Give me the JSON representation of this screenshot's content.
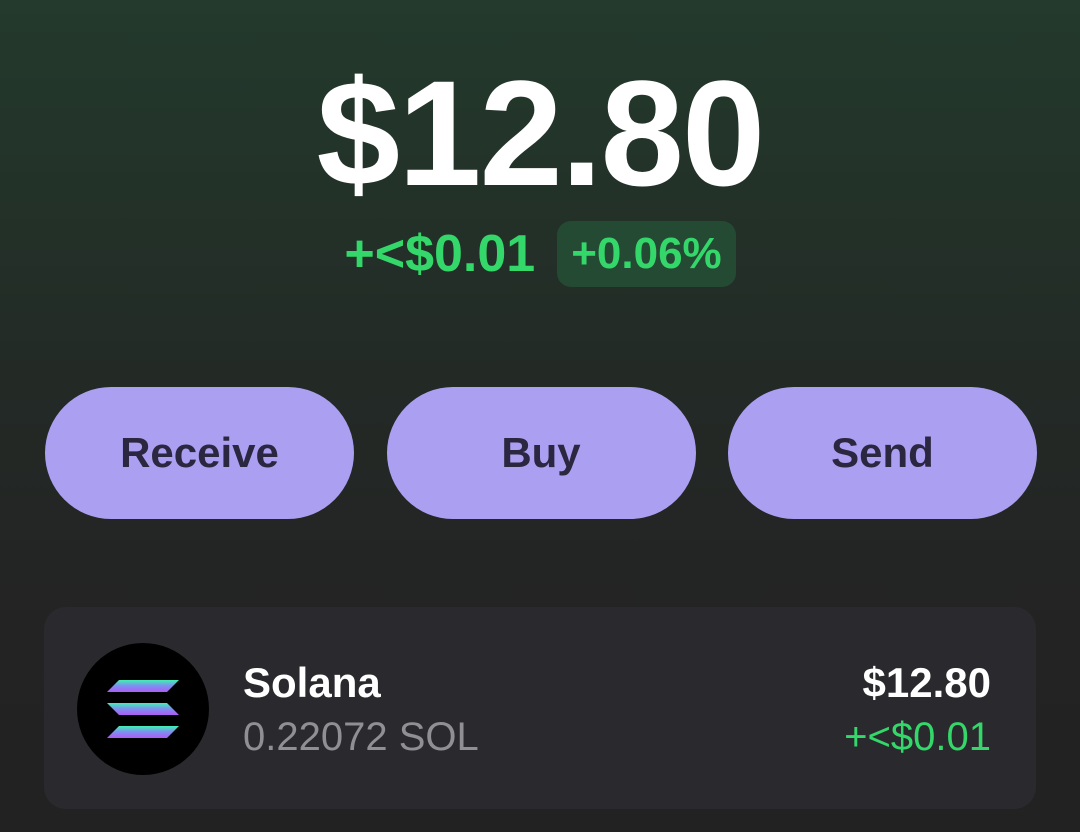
{
  "portfolio": {
    "balance": "$12.80",
    "change_amount": "+<$0.01",
    "change_percent": "+0.06%",
    "positive_color": "#34d769"
  },
  "actions": {
    "receive_label": "Receive",
    "buy_label": "Buy",
    "send_label": "Send",
    "button_color": "#ab9ff2"
  },
  "tokens": [
    {
      "name": "Solana",
      "amount": "0.22072 SOL",
      "value": "$12.80",
      "change": "+<$0.01",
      "icon": "solana-logo-icon"
    }
  ]
}
